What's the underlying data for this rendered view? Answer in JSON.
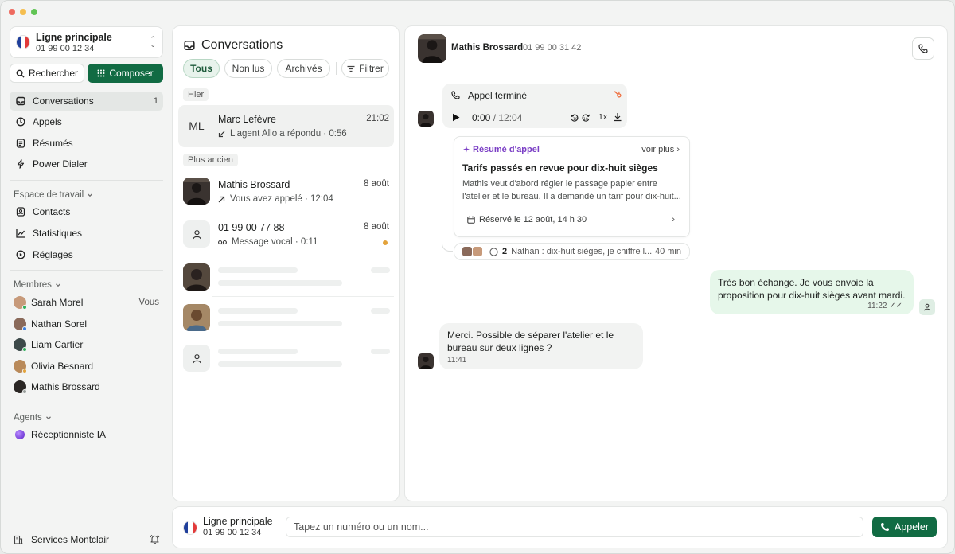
{
  "colors": {
    "accent": "#116b43",
    "unread": "#e3a33b",
    "summary": "#7b3fc5",
    "outgoing_bubble": "#e6f7ea"
  },
  "sidebar": {
    "line": {
      "title": "Ligne principale",
      "number": "01 99 00 12 34"
    },
    "search_label": "Rechercher",
    "compose_label": "Composer",
    "nav": [
      {
        "label": "Conversations",
        "count": "1",
        "icon": "inbox-icon"
      },
      {
        "label": "Appels",
        "icon": "clock-icon"
      },
      {
        "label": "Résumés",
        "icon": "document-icon"
      },
      {
        "label": "Power Dialer",
        "icon": "lightning-icon"
      }
    ],
    "workspace_label": "Espace de travail",
    "workspace": [
      {
        "label": "Contacts",
        "icon": "contacts-icon"
      },
      {
        "label": "Statistiques",
        "icon": "chart-icon"
      },
      {
        "label": "Réglages",
        "icon": "settings-icon"
      }
    ],
    "members_label": "Membres",
    "members": [
      {
        "name": "Sarah Morel",
        "tag": "Vous",
        "status": "#2fb05a",
        "avatar": "#c79a7a"
      },
      {
        "name": "Nathan Sorel",
        "status": "#3b7fe0",
        "avatar": "#8a6a5a"
      },
      {
        "name": "Liam Cartier",
        "status": "#2fb05a",
        "avatar": "#3d4a4a"
      },
      {
        "name": "Olivia Besnard",
        "status": "#e3a33b",
        "avatar": "#b98a5a"
      },
      {
        "name": "Mathis Brossard",
        "status": "#9aa09d",
        "avatar": "#2a2624"
      }
    ],
    "agents_label": "Agents",
    "agents": [
      {
        "name": "Réceptionniste IA"
      }
    ],
    "org_name": "Services Montclair"
  },
  "conversations": {
    "title": "Conversations",
    "filters": [
      "Tous",
      "Non lus",
      "Archivés"
    ],
    "filter_button": "Filtrer",
    "group_yesterday": "Hier",
    "group_older": "Plus ancien",
    "items": [
      {
        "initials": "ML",
        "name": "Marc Lefèvre",
        "date": "21:02",
        "sub": "L'agent Allo a répondu · 0:56",
        "icon": "arrow-in-icon"
      },
      {
        "name": "Mathis Brossard",
        "date": "8 août",
        "sub": "Vous avez appelé · 12:04",
        "icon": "arrow-out-icon"
      },
      {
        "name": "01 99 00 77 88",
        "date": "8 août",
        "sub": "Message vocal · 0:11",
        "icon": "voicemail-icon"
      }
    ]
  },
  "chat": {
    "contact_name": "Mathis Brossard",
    "contact_number": "01 99 00 31 42",
    "call": {
      "title": "Appel terminé",
      "position": "0:00",
      "duration": "/ 12:04",
      "speed": "1x"
    },
    "summary": {
      "label": "Résumé d'appel",
      "more": "voir plus",
      "title": "Tarifs passés en revue pour dix-huit sièges",
      "text": "Mathis veut d'abord régler le passage papier entre l'atelier et le bureau. Il a demandé un tarif pour dix-huit...",
      "booking": "Réservé le 12 août, 14 h 30"
    },
    "thread": {
      "count": "2",
      "preview": "Nathan : dix-huit sièges, je chiffre l...",
      "ago": "40 min"
    },
    "messages": [
      {
        "text": "Très bon échange. Je vous envoie la proposition pour dix-huit sièges avant mardi.",
        "time": "11:22"
      },
      {
        "text": "Merci. Possible de séparer l'atelier et le bureau sur deux lignes ?",
        "time": "11:41"
      }
    ]
  },
  "dialer": {
    "line_title": "Ligne principale",
    "line_number": "01 99 00 12 34",
    "placeholder": "Tapez un numéro ou un nom...",
    "call_label": "Appeler"
  }
}
